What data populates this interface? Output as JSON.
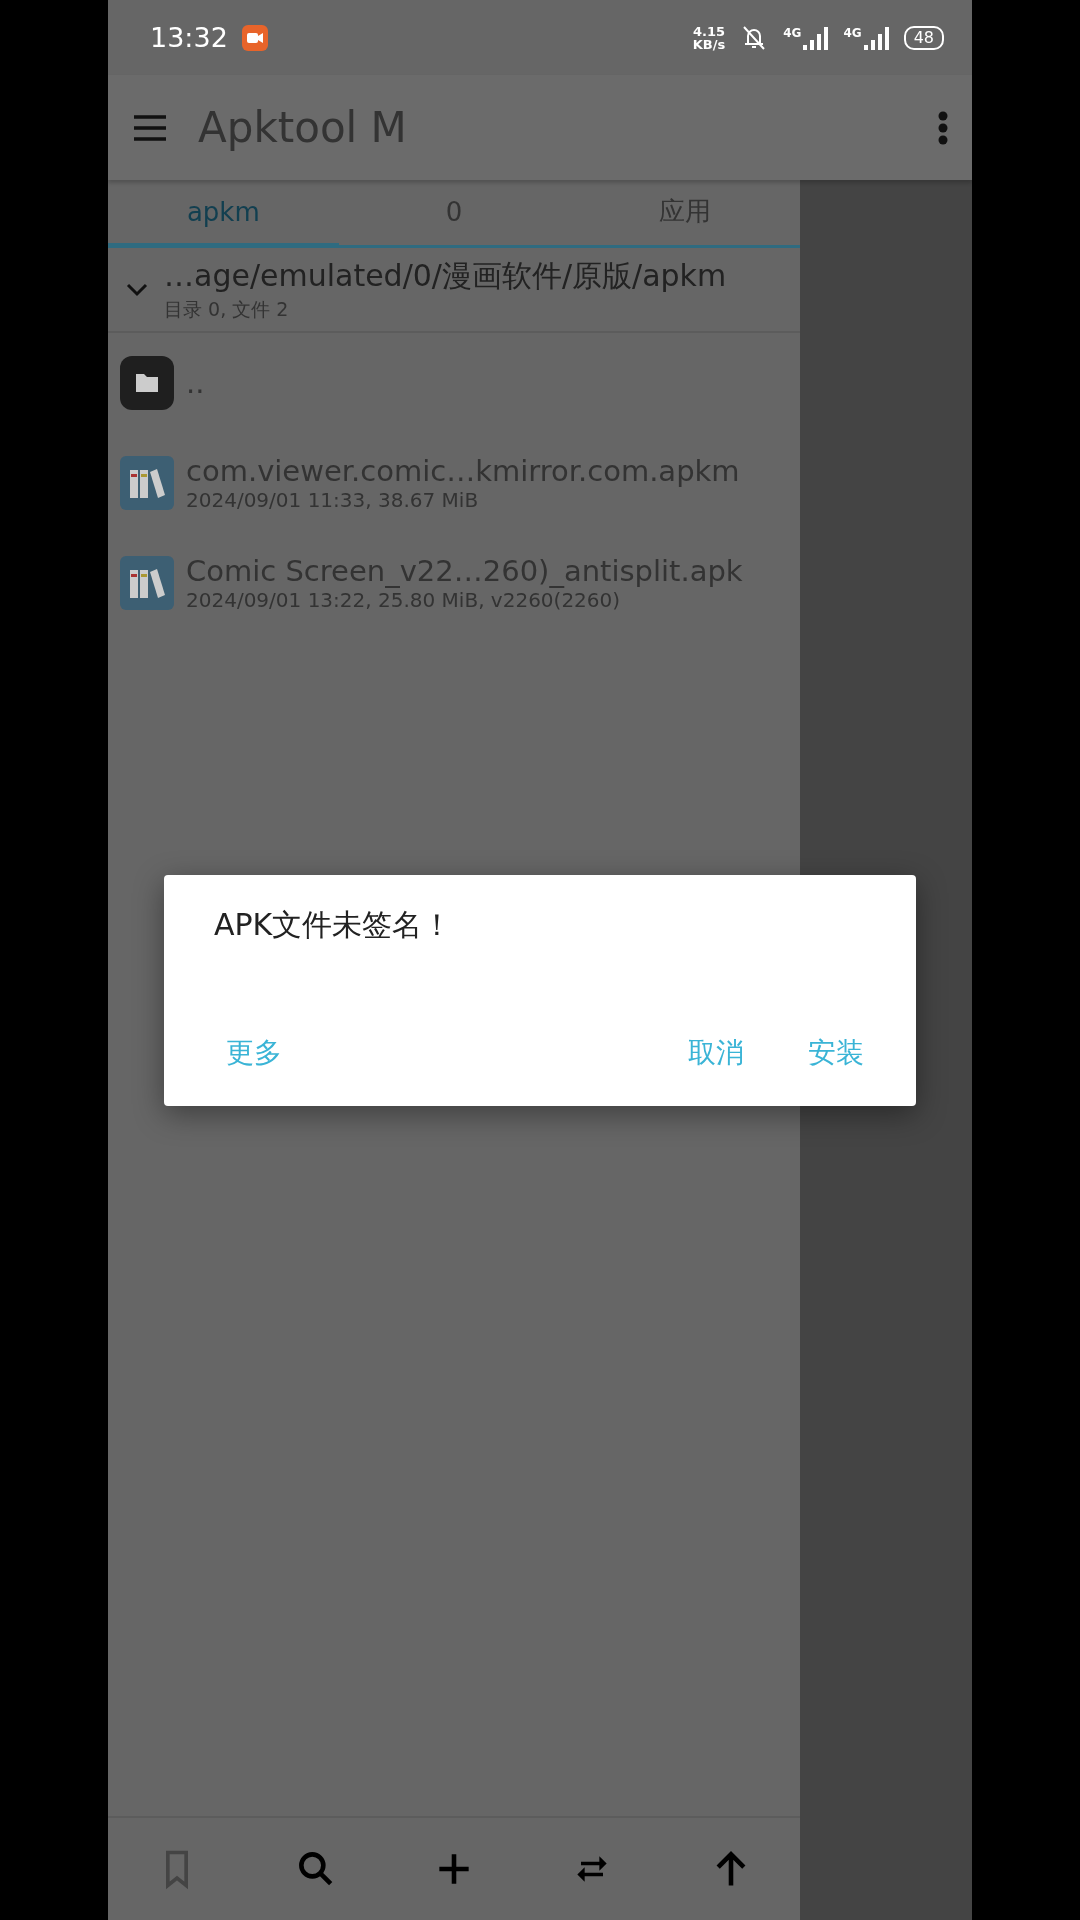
{
  "status_bar": {
    "time": "13:32",
    "net_speed": [
      "4.15",
      "KB/s"
    ],
    "networks": [
      "4G",
      "4G"
    ],
    "battery": "48"
  },
  "app_bar": {
    "title": "Apktool M"
  },
  "tabs": [
    {
      "label": "apkm",
      "selected": true
    },
    {
      "label": "0",
      "selected": false
    },
    {
      "label": "应用",
      "selected": false
    }
  ],
  "path": {
    "text": "…age/emulated/0/漫画软件/原版/apkm",
    "summary": "目录 0, 文件 2",
    "expanded": true
  },
  "files": [
    {
      "kind": "folder",
      "name": ".."
    },
    {
      "kind": "apk",
      "name": "com.viewer.comic…kmirror.com.apkm",
      "details": "2024/09/01 11:33, 38.67 MiB"
    },
    {
      "kind": "apk",
      "name": "Comic Screen_v22…260)_antisplit.apk",
      "details": "2024/09/01 13:22, 25.80 MiB, v2260(2260)"
    }
  ],
  "bottom_bar": [
    {
      "kind": "bookmark",
      "disabled": true
    },
    {
      "kind": "search",
      "disabled": false
    },
    {
      "kind": "add",
      "disabled": false
    },
    {
      "kind": "swap",
      "disabled": false
    },
    {
      "kind": "up",
      "disabled": false
    }
  ],
  "dialog": {
    "message": "APK文件未签名！",
    "buttons": [
      "更多",
      "取消",
      "安装"
    ]
  }
}
